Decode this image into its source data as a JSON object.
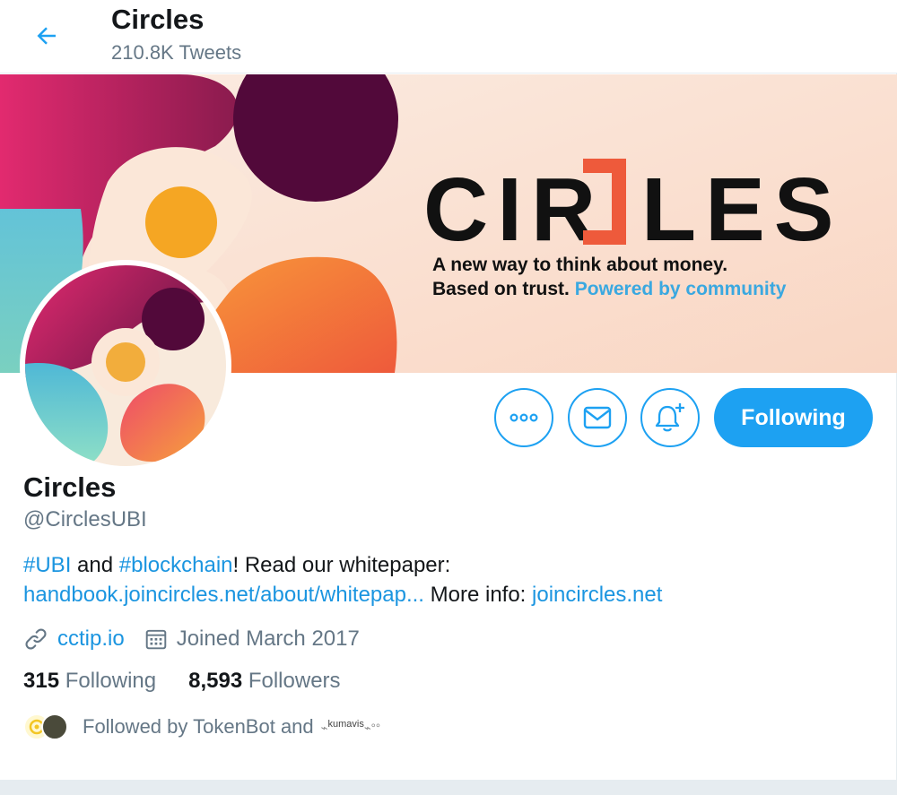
{
  "header": {
    "back_icon": "arrow-left-icon",
    "title": "Circles",
    "subtitle": "210.8K Tweets"
  },
  "banner": {
    "wordmark": "CIRCLES",
    "tagline_line1": "A new way to think about money.",
    "tagline_line2_black": "Based on trust.",
    "tagline_line2_blue": "Powered by community"
  },
  "actions": {
    "more_icon": "more-icon",
    "message_icon": "envelope-icon",
    "notify_icon": "bell-plus-icon",
    "follow_label": "Following"
  },
  "profile": {
    "name": "Circles",
    "handle": "@CirclesUBI",
    "bio": {
      "tag1": "#UBI",
      "text1": " and ",
      "tag2": "#blockchain",
      "text2": "! Read our whitepaper:",
      "link1": "handbook.joincircles.net/about/whitepap...",
      "text3": " More info: ",
      "link2": "joincircles.net"
    },
    "website": "cctip.io",
    "joined": "Joined March 2017",
    "following_count": "315",
    "following_label": "Following",
    "followers_count": "8,593",
    "followers_label": "Followers",
    "followed_by": "Followed by TokenBot and",
    "followed_by_name": "kumavis"
  },
  "colors": {
    "accent": "#1da1f2",
    "link": "#1b95e0",
    "muted": "#657786",
    "text": "#14171a"
  }
}
